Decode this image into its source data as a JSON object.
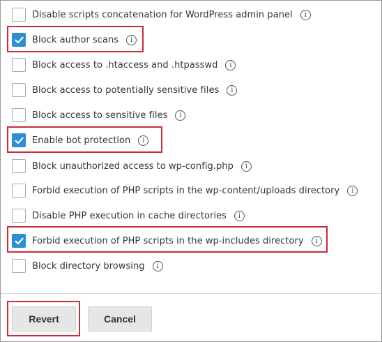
{
  "options": [
    {
      "label": "Disable scripts concatenation for WordPress admin panel",
      "checked": false,
      "info_icon": "info-icon"
    },
    {
      "label": "Block author scans",
      "checked": true,
      "info_icon": "info-icon"
    },
    {
      "label": "Block access to .htaccess and .htpasswd",
      "checked": false,
      "info_icon": "info-icon"
    },
    {
      "label": "Block access to potentially sensitive files",
      "checked": false,
      "info_icon": "info-icon"
    },
    {
      "label": "Block access to sensitive files",
      "checked": false,
      "info_icon": "info-icon"
    },
    {
      "label": "Enable bot protection",
      "checked": true,
      "info_icon": "info-icon"
    },
    {
      "label": "Block unauthorized access to wp-config.php",
      "checked": false,
      "info_icon": "info-icon"
    },
    {
      "label": "Forbid execution of PHP scripts in the wp-content/uploads directory",
      "checked": false,
      "info_icon": "info-icon"
    },
    {
      "label": "Disable PHP execution in cache directories",
      "checked": false,
      "info_icon": "info-icon"
    },
    {
      "label": "Forbid execution of PHP scripts in the wp-includes directory",
      "checked": true,
      "info_icon": "info-icon"
    },
    {
      "label": "Block directory browsing",
      "checked": false,
      "info_icon": "info-icon"
    }
  ],
  "buttons": {
    "revert_label": "Revert",
    "cancel_label": "Cancel"
  },
  "colors": {
    "checkbox_checked": "#2b8fd6",
    "highlight_border": "#d0293b",
    "button_bg": "#e6e6e6"
  }
}
